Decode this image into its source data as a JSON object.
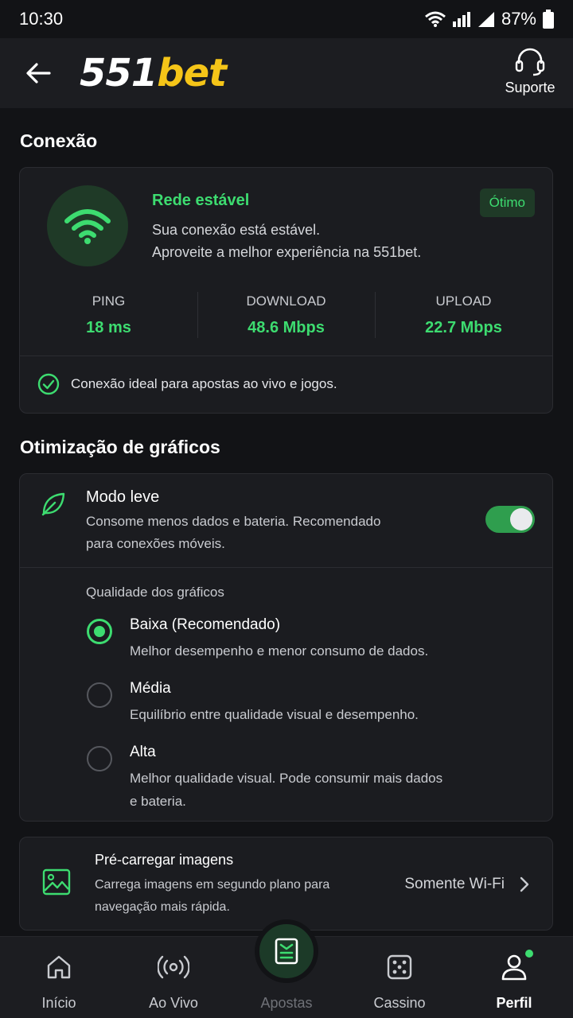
{
  "status_bar": {
    "time": "10:30",
    "battery": "87%"
  },
  "header": {
    "logo_number": "551",
    "logo_brand": "bet",
    "support_label": "Suporte"
  },
  "connection": {
    "section_title": "Conexão",
    "status_title": "Rede estável",
    "status_line1": "Sua conexão está estável.",
    "status_line2": "Aproveite a melhor experiência na 551bet.",
    "badge": "Ótimo",
    "stats": [
      {
        "label": "PING",
        "value": "18 ms"
      },
      {
        "label": "DOWNLOAD",
        "value": "48.6 Mbps"
      },
      {
        "label": "UPLOAD",
        "value": "22.7 Mbps"
      }
    ],
    "ideal_message": "Conexão ideal para apostas ao vivo e jogos."
  },
  "graphics": {
    "section_title": "Otimização de gráficos",
    "light_mode": {
      "title": "Modo leve",
      "description_line1": "Consome menos dados e bateria. Recomendado",
      "description_line2": "para conexões móveis.",
      "enabled": true
    },
    "quality_label": "Qualidade dos gráficos",
    "options": [
      {
        "title": "Baixa (Recomendado)",
        "description": "Melhor desempenho e menor consumo de dados.",
        "selected": true
      },
      {
        "title": "Média",
        "description": "Equilíbrio entre qualidade visual e desempenho.",
        "selected": false
      },
      {
        "title": "Alta",
        "description_line1": "Melhor qualidade visual. Pode consumir mais dados",
        "description_line2": "e bateria.",
        "selected": false
      }
    ]
  },
  "preload": {
    "title": "Pré-carregar imagens",
    "description_line1": "Carrega imagens em segundo plano para",
    "description_line2": "navegação mais rápida.",
    "value": "Somente Wi-Fi"
  },
  "bottom_nav": {
    "items": [
      {
        "label": "Início",
        "icon": "home-icon"
      },
      {
        "label": "Ao Vivo",
        "icon": "broadcast-icon"
      },
      {
        "label": "Apostas",
        "icon": "betslip-icon"
      },
      {
        "label": "Cassino",
        "icon": "dice-icon"
      },
      {
        "label": "Perfil",
        "icon": "user-icon"
      }
    ]
  },
  "colors": {
    "accent": "#3ddc70",
    "brand": "#f5c518",
    "background": "#121316",
    "card": "#1b1c20"
  }
}
